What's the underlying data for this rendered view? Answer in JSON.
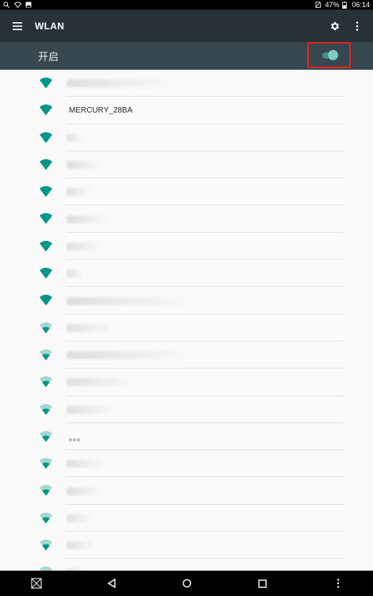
{
  "status_bar": {
    "left_icons": [
      "search-icon",
      "wifi-icon",
      "image-icon"
    ],
    "battery": "47%",
    "time": "06:14"
  },
  "app_bar": {
    "menu_icon": "menu-icon",
    "title": "WLAN",
    "settings_icon": "gear-icon",
    "overflow_icon": "more-vert-icon"
  },
  "switch_bar": {
    "label": "开启",
    "enabled": true,
    "accent": "#80cbc4"
  },
  "networks": [
    {
      "ssid": "",
      "blurred": true
    },
    {
      "ssid": "MERCURY_28BA",
      "blurred": false
    },
    {
      "ssid": "",
      "blurred": true
    },
    {
      "ssid": "",
      "blurred": true
    },
    {
      "ssid": "",
      "blurred": true
    },
    {
      "ssid": "",
      "blurred": true
    },
    {
      "ssid": "",
      "blurred": true
    },
    {
      "ssid": "",
      "blurred": true
    },
    {
      "ssid": "",
      "blurred": true
    },
    {
      "ssid": "",
      "blurred": true
    },
    {
      "ssid": "",
      "blurred": true
    },
    {
      "ssid": "",
      "blurred": true
    },
    {
      "ssid": "",
      "blurred": true
    },
    {
      "ssid": "。。。",
      "blurred": false
    },
    {
      "ssid": "",
      "blurred": true
    },
    {
      "ssid": "",
      "blurred": true
    },
    {
      "ssid": "",
      "blurred": true
    },
    {
      "ssid": "",
      "blurred": true
    },
    {
      "ssid": "",
      "blurred": true
    }
  ],
  "colors": {
    "app_bar": "#263238",
    "switch_bar": "#37474f",
    "wifi_icon": "#009688",
    "highlight_box": "#e0261d"
  },
  "nav_bar": {
    "buttons": [
      "screenshot-icon",
      "back-icon",
      "home-icon",
      "recents-icon",
      "more-vert-icon"
    ]
  }
}
